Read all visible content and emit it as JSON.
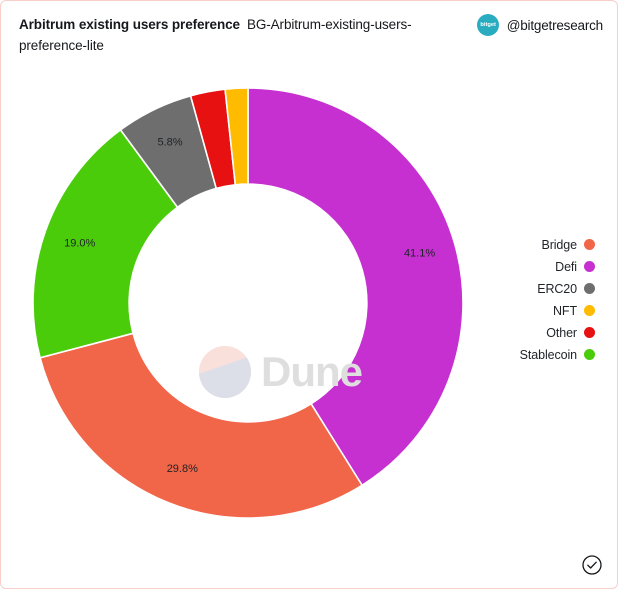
{
  "header": {
    "title_main": "Arbitrum existing users preference",
    "title_sub": "BG-Arbitrum-existing-users-preference-lite",
    "handle": "@bitgetresearch",
    "avatar_mark": "bitget",
    "avatar_icon": "bitget-avatar-icon",
    "avatar_color": "#2aacc0"
  },
  "watermark": {
    "text": "Dune",
    "logo_icon": "dune-logo-icon",
    "logo_top_color": "#fae0da",
    "logo_bottom_color": "#dcdee8",
    "text_color": "#dedede"
  },
  "footer": {
    "badge_icon": "check-circle-icon"
  },
  "chart_data": {
    "type": "pie",
    "variant": "donut",
    "title": "Arbitrum existing users preference",
    "subtitle": "BG-Arbitrum-existing-users-preference-lite",
    "xlabel": "",
    "ylabel": "",
    "legend_position": "right",
    "grid": false,
    "value_unit": "%",
    "start_angle_deg": 0,
    "direction": "clockwise",
    "inner_radius_ratio": 0.553,
    "categories": [
      "Defi",
      "Bridge",
      "Stablecoin",
      "ERC20",
      "Other",
      "NFT"
    ],
    "values": [
      41.1,
      29.8,
      19.0,
      5.8,
      2.6,
      1.7
    ],
    "labels_shown": [
      "41.1%",
      "29.8%",
      "19.0%",
      "5.8%",
      "",
      ""
    ],
    "slices": [
      {
        "name": "Defi",
        "value": 41.1,
        "label": "41.1%",
        "color": "#c62fd0"
      },
      {
        "name": "Bridge",
        "value": 29.8,
        "label": "29.8%",
        "color": "#f16548"
      },
      {
        "name": "Stablecoin",
        "value": 19.0,
        "label": "19.0%",
        "color": "#4bcc0b"
      },
      {
        "name": "ERC20",
        "value": 5.8,
        "label": "5.8%",
        "color": "#6e6e6e"
      },
      {
        "name": "Other",
        "value": 2.6,
        "label": "",
        "color": "#e71111"
      },
      {
        "name": "NFT",
        "value": 1.7,
        "label": "",
        "color": "#ffbb00"
      }
    ],
    "legend": [
      {
        "label": "Bridge",
        "color": "#f16548"
      },
      {
        "label": "Defi",
        "color": "#c62fd0"
      },
      {
        "label": "ERC20",
        "color": "#6e6e6e"
      },
      {
        "label": "NFT",
        "color": "#ffbb00"
      },
      {
        "label": "Other",
        "color": "#e71111"
      },
      {
        "label": "Stablecoin",
        "color": "#4bcc0b"
      }
    ]
  }
}
